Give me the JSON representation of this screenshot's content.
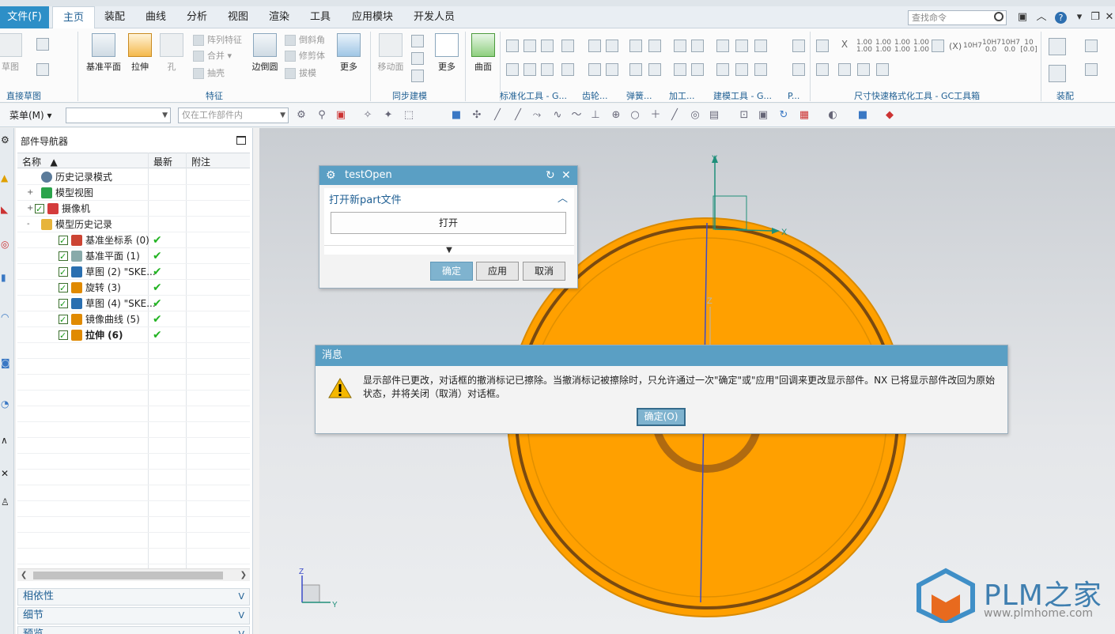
{
  "ribbon": {
    "file_tab": "文件(F)",
    "tabs": [
      "主页",
      "装配",
      "曲线",
      "分析",
      "视图",
      "渲染",
      "工具",
      "应用模块",
      "开发人员"
    ],
    "search_placeholder": "查找命令",
    "groups": {
      "sketch": "直接草图",
      "feature": "特征",
      "sync": "同步建模",
      "std": "标准化工具 - G...",
      "gear": "齿轮...",
      "spring": "弹簧...",
      "machining": "加工...",
      "modeling": "建模工具 - G...",
      "p": "P...",
      "dim": "尺寸快速格式化工具 - GC工具箱",
      "assembly": "装配"
    },
    "buttons": {
      "sketch": "草图",
      "datum_plane": "基准平面",
      "extrude": "拉伸",
      "hole": "孔",
      "pattern_feature": "阵列特征",
      "unite": "合并",
      "shell": "抽壳",
      "edge_blend": "边倒圆",
      "chamfer": "倒斜角",
      "trim_body": "修剪体",
      "draft": "拔模",
      "more1": "更多",
      "move_face": "移动面",
      "more2": "更多",
      "surface": "曲面"
    },
    "dim_labels": [
      "1.00\n1.00",
      "1.00\n1.00",
      "1.00\n1.00",
      "1.00\n1.00",
      "10H7",
      "10H7\n0.0",
      "10H7\n0.0",
      "10\n[0.0]"
    ]
  },
  "toolbar2": {
    "menu": "菜单(M)",
    "filter_placeholder": "",
    "scope": "仅在工作部件内"
  },
  "navigator": {
    "title": "部件导航器",
    "columns": [
      "名称",
      "最新",
      "附注"
    ],
    "rows": [
      {
        "label": "历史记录模式",
        "level": 0,
        "check": false,
        "ok": false,
        "bold": false,
        "icon": "clock-icon"
      },
      {
        "label": "模型视图",
        "level": 0,
        "check": false,
        "ok": false,
        "bold": false,
        "icon": "model-view-icon",
        "expand": "+"
      },
      {
        "label": "摄像机",
        "level": 0,
        "check": true,
        "ok": false,
        "bold": false,
        "icon": "camera-icon",
        "expand": "+"
      },
      {
        "label": "模型历史记录",
        "level": 0,
        "check": false,
        "ok": false,
        "bold": false,
        "icon": "folder-icon",
        "expand": "-"
      },
      {
        "label": "基准坐标系 (0)",
        "level": 1,
        "check": true,
        "ok": true,
        "bold": false,
        "icon": "csys-icon"
      },
      {
        "label": "基准平面 (1)",
        "level": 1,
        "check": true,
        "ok": true,
        "bold": false,
        "icon": "plane-icon"
      },
      {
        "label": "草图 (2) \"SKE...",
        "level": 1,
        "check": true,
        "ok": true,
        "bold": false,
        "icon": "sketch-icon"
      },
      {
        "label": "旋转 (3)",
        "level": 1,
        "check": true,
        "ok": true,
        "bold": false,
        "icon": "revolve-icon"
      },
      {
        "label": "草图 (4) \"SKE...",
        "level": 1,
        "check": true,
        "ok": true,
        "bold": false,
        "icon": "sketch-icon"
      },
      {
        "label": "镜像曲线 (5)",
        "level": 1,
        "check": true,
        "ok": true,
        "bold": false,
        "icon": "mirror-curve-icon"
      },
      {
        "label": "拉伸 (6)",
        "level": 1,
        "check": true,
        "ok": true,
        "bold": true,
        "icon": "extrude-icon"
      }
    ],
    "accordions": [
      "相依性",
      "细节",
      "预览"
    ]
  },
  "testopen": {
    "title": "testOpen",
    "section_title": "打开新part文件",
    "open_button": "打开",
    "ok": "确定",
    "apply": "应用",
    "cancel": "取消"
  },
  "message": {
    "title": "消息",
    "line1": "显示部件已更改，对话框的撤消标记已擦除。当撤消标记被擦除时，只允许通过一次\"确定\"或\"应用\"回调来更改显示部件。NX 已将显示部件改回为原始",
    "line2": "状态，并将关闭（取消）对话框。",
    "ok": "确定(O)"
  },
  "viewport": {
    "axis_x": "X",
    "axis_y": "Y",
    "axis_z": "Z",
    "triad_z": "Z",
    "triad_y": "Y"
  },
  "watermark": {
    "brand": "PLM之家",
    "url": "www.plmhome.com"
  },
  "colors": {
    "accent": "#2d8fc7",
    "dialog_title": "#5a9fc4",
    "part": "#ffa000",
    "part_edge": "#7a4a10"
  }
}
